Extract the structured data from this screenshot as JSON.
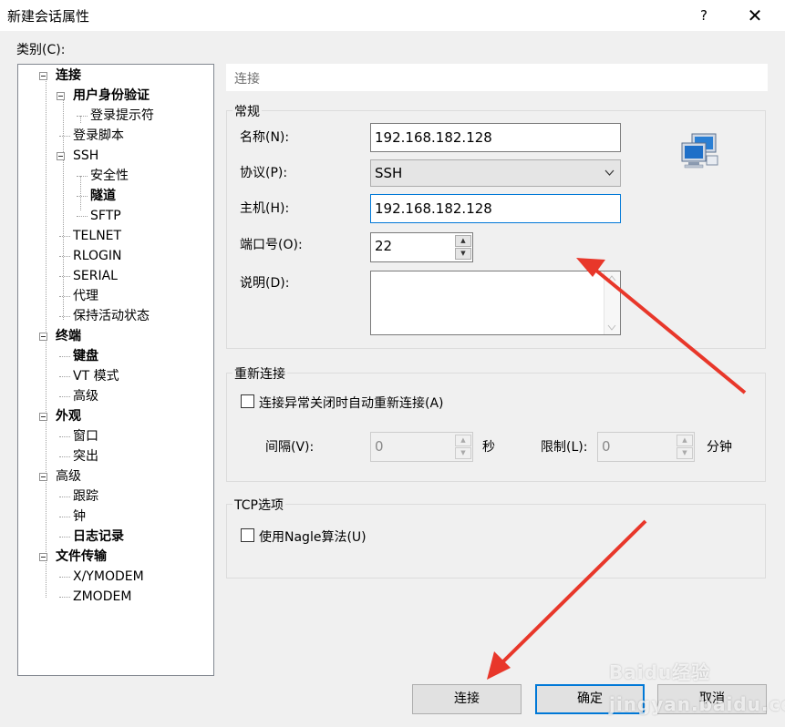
{
  "window": {
    "title": "新建会话属性",
    "help": "?",
    "close": "✕"
  },
  "category_label": "类别(C):",
  "tree": [
    {
      "label": "连接",
      "bold": true,
      "expander": true
    },
    {
      "label": "用户身份验证",
      "bold": true,
      "expander": true
    },
    {
      "label": "登录提示符",
      "bold": false
    },
    {
      "label": "登录脚本",
      "bold": false
    },
    {
      "label": "SSH",
      "bold": false,
      "expander": true
    },
    {
      "label": "安全性",
      "bold": false
    },
    {
      "label": "隧道",
      "bold": true
    },
    {
      "label": "SFTP",
      "bold": false
    },
    {
      "label": "TELNET",
      "bold": false
    },
    {
      "label": "RLOGIN",
      "bold": false
    },
    {
      "label": "SERIAL",
      "bold": false
    },
    {
      "label": "代理",
      "bold": false
    },
    {
      "label": "保持活动状态",
      "bold": false
    },
    {
      "label": "终端",
      "bold": true,
      "expander": true
    },
    {
      "label": "键盘",
      "bold": true
    },
    {
      "label": "VT 模式",
      "bold": false
    },
    {
      "label": "高级",
      "bold": false
    },
    {
      "label": "外观",
      "bold": true,
      "expander": true
    },
    {
      "label": "窗口",
      "bold": false
    },
    {
      "label": "突出",
      "bold": false
    },
    {
      "label": "高级",
      "bold": false,
      "expander": true
    },
    {
      "label": "跟踪",
      "bold": false
    },
    {
      "label": "钟",
      "bold": false
    },
    {
      "label": "日志记录",
      "bold": true
    },
    {
      "label": "文件传输",
      "bold": true,
      "expander": true
    },
    {
      "label": "X/YMODEM",
      "bold": false
    },
    {
      "label": "ZMODEM",
      "bold": false
    }
  ],
  "panel_header": "连接",
  "general": {
    "title": "常规",
    "name_label": "名称(N):",
    "name_value": "192.168.182.128",
    "protocol_label": "协议(P):",
    "protocol_value": "SSH",
    "host_label": "主机(H):",
    "host_value": "192.168.182.128",
    "port_label": "端口号(O):",
    "port_value": "22",
    "desc_label": "说明(D):",
    "desc_value": "",
    "icon": "network-computers-icon"
  },
  "reconnect": {
    "title": "重新连接",
    "checkbox_label": "连接异常关闭时自动重新连接(A)",
    "interval_label": "间隔(V):",
    "interval_value": "0",
    "interval_unit": "秒",
    "limit_label": "限制(L):",
    "limit_value": "0",
    "limit_unit": "分钟"
  },
  "tcp": {
    "title": "TCP选项",
    "nagle_label": "使用Nagle算法(U)"
  },
  "buttons": {
    "connect": "连接",
    "ok": "确定",
    "cancel": "取消"
  },
  "watermark": "Baidu经验 jingyan.baidu.com",
  "colors": {
    "accent": "#0078d7",
    "arrow": "#e8372a"
  }
}
